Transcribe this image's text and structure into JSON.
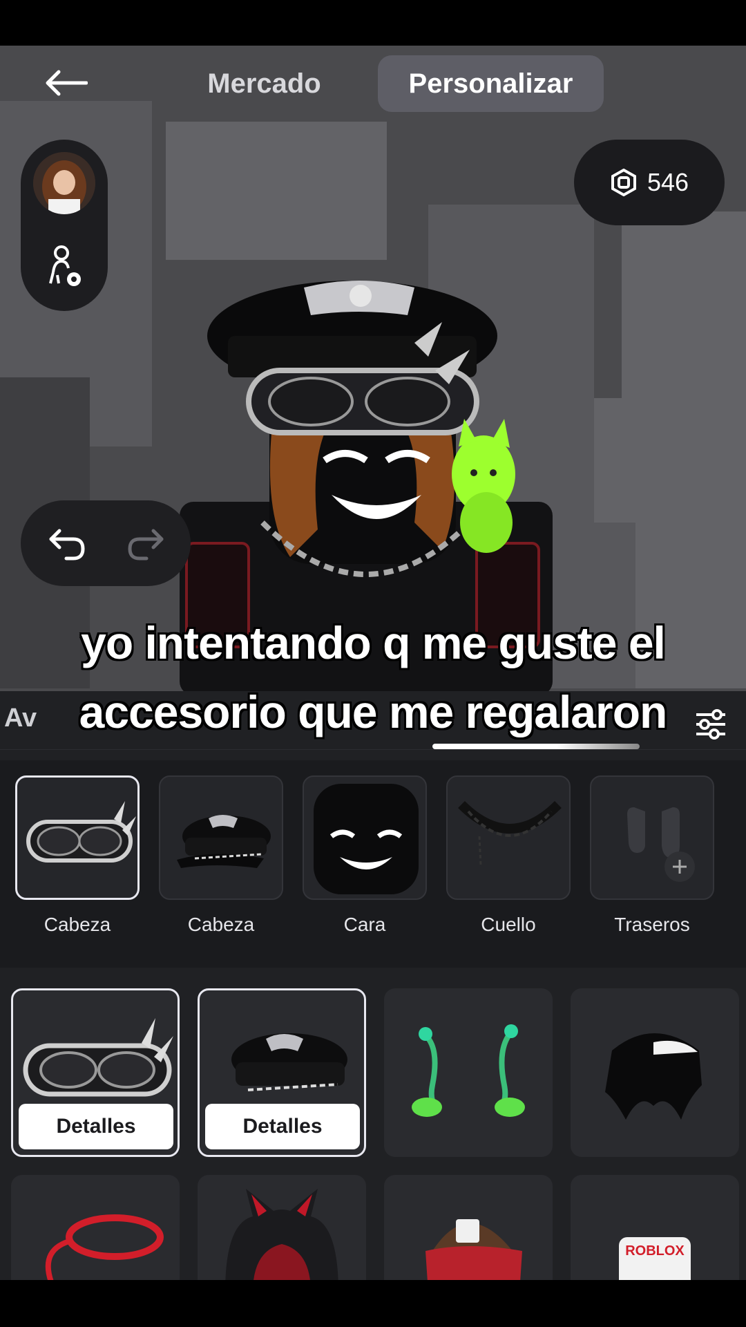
{
  "header": {
    "tabs": [
      {
        "label": "Mercado",
        "active": false
      },
      {
        "label": "Personalizar",
        "active": true
      }
    ]
  },
  "robux": {
    "amount": "546",
    "icon": "robux-icon"
  },
  "caption": {
    "line1": "yo intentando q me guste el",
    "line2": "accesorio que me regalaron"
  },
  "panel": {
    "title": "Av"
  },
  "equipped": [
    {
      "label": "Cabeza",
      "icon": "goggles-icon",
      "selected": true
    },
    {
      "label": "Cabeza",
      "icon": "officer-cap-icon",
      "selected": false
    },
    {
      "label": "Cara",
      "icon": "face-icon",
      "selected": false
    },
    {
      "label": "Cuello",
      "icon": "chain-necklace-icon",
      "selected": false
    },
    {
      "label": "Traseros",
      "icon": "back-add-icon",
      "selected": false
    }
  ],
  "grid": {
    "details_label": "Detalles",
    "items": [
      {
        "icon": "goggles-icon",
        "selected": true
      },
      {
        "icon": "officer-cap-icon",
        "selected": true
      },
      {
        "icon": "sprout-antennae-icon",
        "selected": false
      },
      {
        "icon": "black-hair-icon",
        "selected": false
      },
      {
        "icon": "red-headphones-icon",
        "selected": false
      },
      {
        "icon": "cat-ears-hood-icon",
        "selected": false
      },
      {
        "icon": "roblox-cap-icon",
        "selected": false
      },
      {
        "icon": "roblox-shirt-icon",
        "selected": false
      }
    ],
    "shirt_text": "ROBLOX"
  },
  "colors": {
    "accent_green": "#9dff2e",
    "panel_bg": "#202124",
    "scene_bg": "#4a4a4d"
  }
}
